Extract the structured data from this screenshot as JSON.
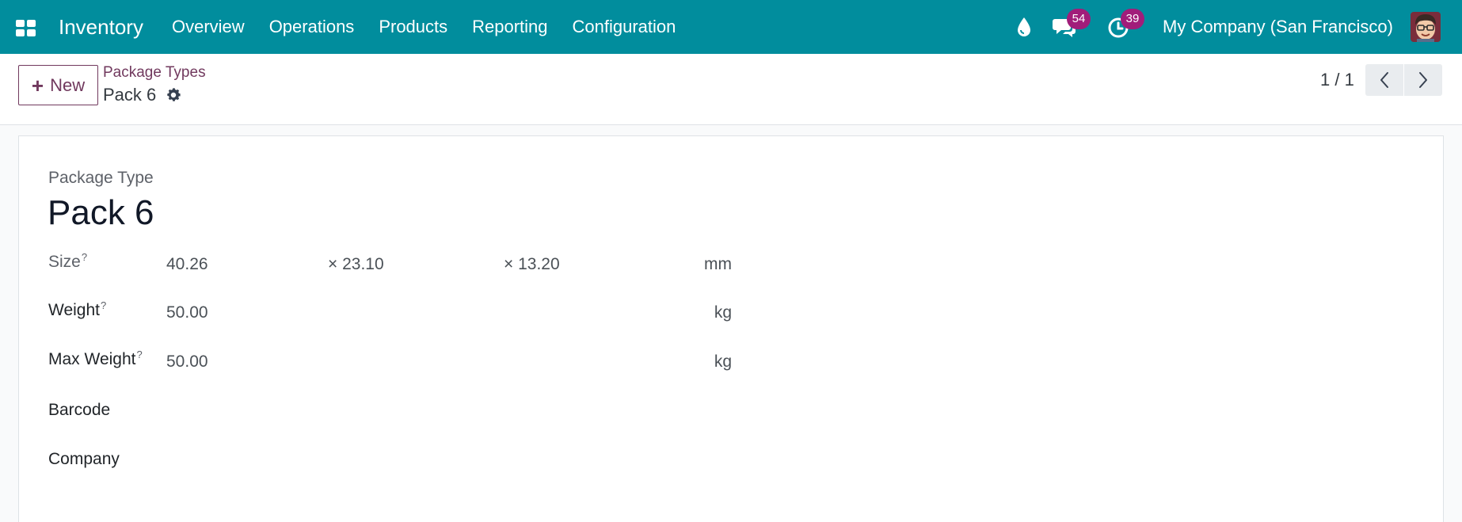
{
  "navbar": {
    "app_name": "Inventory",
    "menu": [
      "Overview",
      "Operations",
      "Products",
      "Reporting",
      "Configuration"
    ],
    "messages_count": "54",
    "activities_count": "39",
    "company": "My Company (San Francisco)",
    "color": "#018d9d",
    "badge_color": "#a11d7a"
  },
  "control": {
    "new_label": "New",
    "breadcrumb_parent": "Package Types",
    "breadcrumb_current": "Pack 6",
    "pager": "1 / 1",
    "accent_color": "#71395e"
  },
  "form": {
    "type_label": "Package Type",
    "name": "Pack 6",
    "size": {
      "label": "Size",
      "help": "?",
      "length": "40.26",
      "width": "× 23.10",
      "height": "× 13.20",
      "unit": "mm"
    },
    "weight": {
      "label": "Weight",
      "help": "?",
      "value": "50.00",
      "unit": "kg"
    },
    "max_weight": {
      "label": "Max Weight",
      "help": "?",
      "value": "50.00",
      "unit": "kg"
    },
    "barcode": {
      "label": "Barcode",
      "value": ""
    },
    "company": {
      "label": "Company",
      "value": ""
    }
  }
}
